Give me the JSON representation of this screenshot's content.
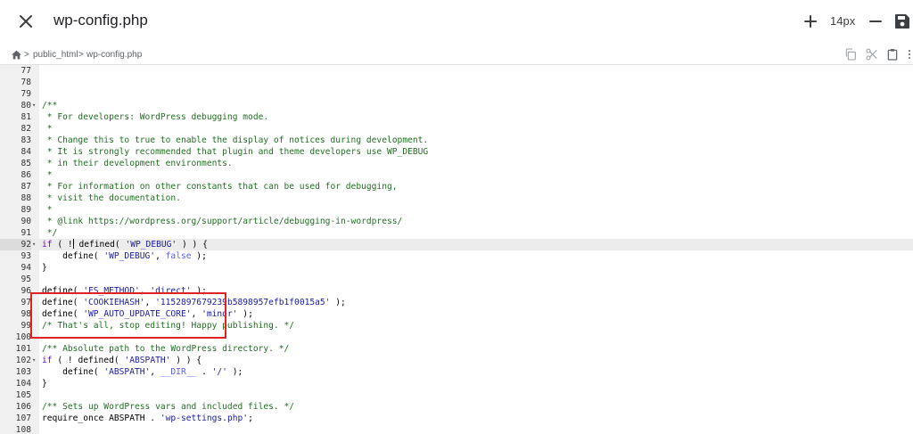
{
  "header": {
    "title": "wp-config.php",
    "font_size": "14px",
    "icons": {
      "close": "close-icon",
      "plus": "plus-icon",
      "minus": "minus-icon",
      "save": "save-icon"
    }
  },
  "breadcrumb": {
    "items": [
      "public_html",
      "wp-config.php"
    ],
    "separator": ">"
  },
  "toolbar": {
    "icons": [
      "copy-icon",
      "scissors-icon",
      "clipboard-icon",
      "more-icon"
    ]
  },
  "editor": {
    "active_line": 92,
    "lines": [
      {
        "n": "77",
        "fold": "",
        "tokens": []
      },
      {
        "n": "78",
        "fold": "",
        "tokens": []
      },
      {
        "n": "79",
        "fold": "",
        "tokens": []
      },
      {
        "n": "80",
        "fold": "▾",
        "tokens": [
          {
            "t": "comment",
            "v": "/**"
          }
        ]
      },
      {
        "n": "81",
        "fold": "",
        "tokens": [
          {
            "t": "comment",
            "v": " * For developers: WordPress debugging mode."
          }
        ]
      },
      {
        "n": "82",
        "fold": "",
        "tokens": [
          {
            "t": "comment",
            "v": " *"
          }
        ]
      },
      {
        "n": "83",
        "fold": "",
        "tokens": [
          {
            "t": "comment",
            "v": " * Change this to true to enable the display of notices during development."
          }
        ]
      },
      {
        "n": "84",
        "fold": "",
        "tokens": [
          {
            "t": "comment",
            "v": " * It is strongly recommended that plugin and theme developers use WP_DEBUG"
          }
        ]
      },
      {
        "n": "85",
        "fold": "",
        "tokens": [
          {
            "t": "comment",
            "v": " * in their development environments."
          }
        ]
      },
      {
        "n": "86",
        "fold": "",
        "tokens": [
          {
            "t": "comment",
            "v": " *"
          }
        ]
      },
      {
        "n": "87",
        "fold": "",
        "tokens": [
          {
            "t": "comment",
            "v": " * For information on other constants that can be used for debugging,"
          }
        ]
      },
      {
        "n": "88",
        "fold": "",
        "tokens": [
          {
            "t": "comment",
            "v": " * visit the documentation."
          }
        ]
      },
      {
        "n": "89",
        "fold": "",
        "tokens": [
          {
            "t": "comment",
            "v": " *"
          }
        ]
      },
      {
        "n": "90",
        "fold": "",
        "tokens": [
          {
            "t": "comment",
            "v": " * @link https://wordpress.org/support/article/debugging-in-wordpress/"
          }
        ]
      },
      {
        "n": "91",
        "fold": "",
        "tokens": [
          {
            "t": "comment",
            "v": " */"
          }
        ]
      },
      {
        "n": "92",
        "fold": "▾",
        "tokens": [
          {
            "t": "keyword",
            "v": "if"
          },
          {
            "t": "plain",
            "v": " ( !"
          },
          {
            "t": "cursor",
            "v": ""
          },
          {
            "t": "plain",
            "v": " defined( "
          },
          {
            "t": "string",
            "v": "'WP_DEBUG'"
          },
          {
            "t": "plain",
            "v": " ) ) {"
          }
        ]
      },
      {
        "n": "93",
        "fold": "",
        "tokens": [
          {
            "t": "plain",
            "v": "    define( "
          },
          {
            "t": "string",
            "v": "'WP_DEBUG'"
          },
          {
            "t": "plain",
            "v": ", "
          },
          {
            "t": "const",
            "v": "false"
          },
          {
            "t": "plain",
            "v": " );"
          }
        ]
      },
      {
        "n": "94",
        "fold": "",
        "tokens": [
          {
            "t": "plain",
            "v": "}"
          }
        ]
      },
      {
        "n": "95",
        "fold": "",
        "tokens": []
      },
      {
        "n": "96",
        "fold": "",
        "tokens": [
          {
            "t": "plain",
            "v": "define( "
          },
          {
            "t": "string",
            "v": "'FS_METHOD'"
          },
          {
            "t": "plain",
            "v": ", "
          },
          {
            "t": "string",
            "v": "'direct'"
          },
          {
            "t": "plain",
            "v": " );"
          }
        ]
      },
      {
        "n": "97",
        "fold": "",
        "tokens": [
          {
            "t": "plain",
            "v": "define( "
          },
          {
            "t": "string",
            "v": "'COOKIEHASH'"
          },
          {
            "t": "plain",
            "v": ", "
          },
          {
            "t": "string",
            "v": "'1152897679239b5898957efb1f0015a5'"
          },
          {
            "t": "plain",
            "v": " );"
          }
        ]
      },
      {
        "n": "98",
        "fold": "",
        "tokens": [
          {
            "t": "plain",
            "v": "define( "
          },
          {
            "t": "string",
            "v": "'WP_AUTO_UPDATE_CORE'"
          },
          {
            "t": "plain",
            "v": ", "
          },
          {
            "t": "string",
            "v": "'minor'"
          },
          {
            "t": "plain",
            "v": " );"
          }
        ]
      },
      {
        "n": "99",
        "fold": "",
        "tokens": [
          {
            "t": "comment",
            "v": "/* That's all, stop editing! Happy publishing. */"
          }
        ]
      },
      {
        "n": "100",
        "fold": "",
        "tokens": []
      },
      {
        "n": "101",
        "fold": "",
        "tokens": [
          {
            "t": "comment",
            "v": "/** Absolute path to the WordPress directory. */"
          }
        ]
      },
      {
        "n": "102",
        "fold": "▾",
        "tokens": [
          {
            "t": "keyword",
            "v": "if"
          },
          {
            "t": "plain",
            "v": " ( ! defined( "
          },
          {
            "t": "string",
            "v": "'ABSPATH'"
          },
          {
            "t": "plain",
            "v": " ) ) {"
          }
        ]
      },
      {
        "n": "103",
        "fold": "",
        "tokens": [
          {
            "t": "plain",
            "v": "    define( "
          },
          {
            "t": "string",
            "v": "'ABSPATH'"
          },
          {
            "t": "plain",
            "v": ", "
          },
          {
            "t": "const",
            "v": "__DIR__"
          },
          {
            "t": "plain",
            "v": " . "
          },
          {
            "t": "string",
            "v": "'/'"
          },
          {
            "t": "plain",
            "v": " );"
          }
        ]
      },
      {
        "n": "104",
        "fold": "",
        "tokens": [
          {
            "t": "plain",
            "v": "}"
          }
        ]
      },
      {
        "n": "105",
        "fold": "",
        "tokens": []
      },
      {
        "n": "106",
        "fold": "",
        "tokens": [
          {
            "t": "comment",
            "v": "/** Sets up WordPress vars and included files. */"
          }
        ]
      },
      {
        "n": "107",
        "fold": "",
        "tokens": [
          {
            "t": "plain",
            "v": "require_once ABSPATH . "
          },
          {
            "t": "string",
            "v": "'wp-settings.php'"
          },
          {
            "t": "plain",
            "v": ";"
          }
        ]
      },
      {
        "n": "108",
        "fold": "",
        "tokens": []
      }
    ]
  }
}
